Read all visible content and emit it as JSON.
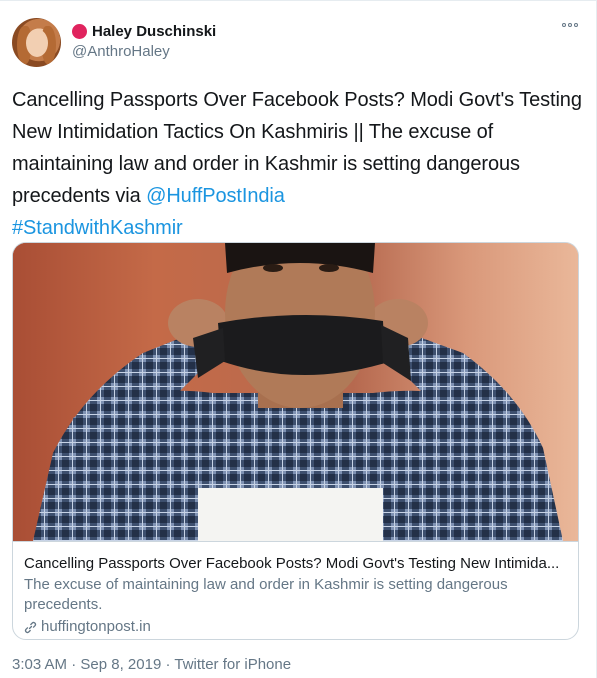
{
  "user": {
    "display_name": "Haley Duschinski",
    "handle": "@AnthroHaley",
    "avatar": "profile-photo",
    "badge_color": "#e0245e"
  },
  "more_menu": {
    "icon": "more-options-icon"
  },
  "tweet": {
    "text_main": "Cancelling Passports Over Facebook Posts? Modi Govt's Testing New Intimidation Tactics On Kashmiris || The excuse of maintaining law and order in Kashmir is setting dangerous precedents via ",
    "mention": "@HuffPostIndia",
    "hashtag": "#StandwithKashmir",
    "link_color": "#1b95e0"
  },
  "card": {
    "image": "man-with-taped-mouth-photo",
    "title": "Cancelling Passports Over Facebook Posts? Modi Govt's Testing New Intimida...",
    "description": "The excuse of maintaining law and order in Kashmir is setting dangerous precedents.",
    "domain": "huffingtonpost.in",
    "domain_icon": "link-icon"
  },
  "footer": {
    "time": "3:03 AM",
    "separator": " · ",
    "date": "Sep 8, 2019",
    "source": "Twitter for iPhone"
  }
}
